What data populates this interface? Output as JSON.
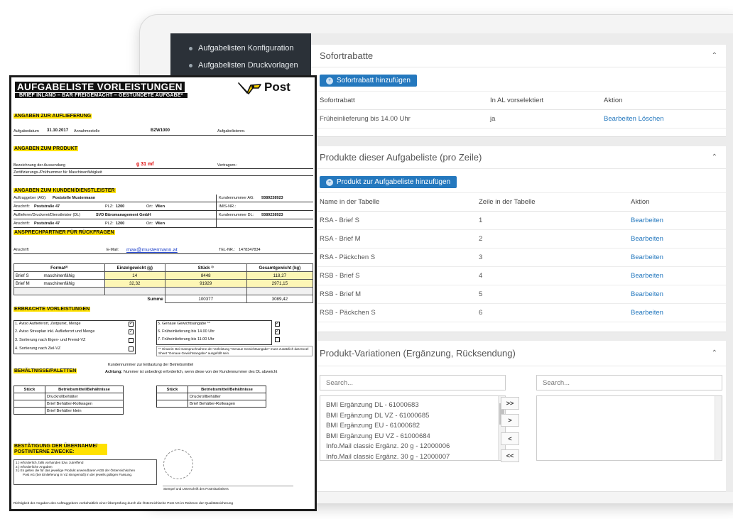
{
  "sidebar": {
    "items": [
      {
        "label": "Aufgabelisten Konfiguration"
      },
      {
        "label": "Aufgabelisten Druckvorlagen"
      }
    ]
  },
  "sofortrabatte": {
    "title": "Sofortrabatte",
    "add_button": "Sofortrabatt hinzufügen",
    "columns": [
      "Sofortrabatt",
      "In AL vorselektiert",
      "Aktion"
    ],
    "rows": [
      {
        "name": "Früheinlieferung bis 14.00 Uhr",
        "preselected": "ja",
        "edit": "Bearbeiten",
        "delete": "Löschen"
      }
    ]
  },
  "produkte": {
    "title": "Produkte dieser Aufgabeliste (pro Zeile)",
    "add_button": "Produkt zur Aufgabeliste hinzufügen",
    "columns": [
      "Name in der Tabelle",
      "Zeile in der Tabelle",
      "Aktion"
    ],
    "rows": [
      {
        "name": "RSA - Brief S",
        "line": "1",
        "action": "Bearbeiten"
      },
      {
        "name": "RSA - Brief M",
        "line": "2",
        "action": "Bearbeiten"
      },
      {
        "name": "RSA - Päckchen S",
        "line": "3",
        "action": "Bearbeiten"
      },
      {
        "name": "RSB - Brief S",
        "line": "4",
        "action": "Bearbeiten"
      },
      {
        "name": "RSB - Brief M",
        "line": "5",
        "action": "Bearbeiten"
      },
      {
        "name": "RSB - Päckchen S",
        "line": "6",
        "action": "Bearbeiten"
      }
    ]
  },
  "variationen": {
    "title": "Produkt-Variationen (Ergänzung, Rücksendung)",
    "search_left_placeholder": "Search...",
    "search_right_placeholder": "Search...",
    "options": [
      "BMI Ergänzung DL - 61000683",
      "BMI Ergänzung DL VZ - 61000685",
      "BMI Ergänzung EU - 61000682",
      "BMI Ergänzung EU VZ - 61000684",
      "Info.Mail classic Ergänz. 20 g - 12000006",
      "Info.Mail classic Ergänz. 30 g - 12000007"
    ],
    "move_buttons": [
      ">>",
      ">",
      "<",
      "<<"
    ]
  },
  "form": {
    "title": "AUFGABELISTE VORLEISTUNGEN",
    "subtitle": "BRIEF INLAND – BAR FREIGEMACHT – GESTUNDETE AUFGABE*",
    "logo_text": "Post",
    "sec_auflieferung": "ANGABEN ZUR AUFLIEFERUNG",
    "aufgabedatum_label": "Aufgabedatum",
    "aufgabedatum": "31.10.2017",
    "annahmestelle_label": "Annahmestelle",
    "annahmestelle": "BZW1000",
    "aufgabelistennr_label": "Aufgabelistennr.",
    "sec_produkt": "ANGABEN ZUM PRODUKT",
    "bezeichnung_label": "Bezeichnung der Aussendung",
    "bezeichnung": "g 31 mf",
    "vertragsnr_label": "Vertragsnr.:",
    "zertifizierung_label": "Zertifizierungs-/Prüfnummer für Maschinenfähigkeit",
    "sec_kunden": "ANGABEN ZUM KUNDEN/DIENSTLEISTER",
    "auftraggeber_label": "Auftraggeber (AG):",
    "auftraggeber": "Poststelle Mustermann",
    "kundennummer_ag_label": "Kundennummer AG:",
    "kundennummer_ag": "9389238923",
    "anschrift_label": "Anschrift:",
    "anschrift1": "Poststraße 47",
    "plz_label": "PLZ:",
    "plz1": "1200",
    "ort_label": "Ort:",
    "ort1": "Wien",
    "imis_label": "IMIS-NR.:",
    "auflieferer_label": "Auflieferer/Druckerei/Dienstleister (DL)",
    "auflieferer": "SVD Büromanagement GmbH",
    "kundennummer_dl_label": "Kundennummer DL:",
    "kundennummer_dl": "9389238923",
    "anschrift2": "Poststraße 47",
    "plz2": "1200",
    "ort2": "Wien",
    "sec_ansprech": "ANSPRECHPARTNER FÜR RÜCKFRAGEN",
    "ansprech_anschrift_label": "Anschrift",
    "email_label": "E-Mail:",
    "email": "max@mustermann.at",
    "tel_label": "TEL-NR.:",
    "tel": "1478347834",
    "table_headers": [
      "Format²⁾",
      "Einzelgewicht (g)",
      "Stück ³⁾",
      "Gesamtgewicht (kg)"
    ],
    "table_rows": [
      {
        "label": "Brief S",
        "format": "maschinenfähig",
        "weight": "14",
        "pieces": "8448",
        "total": "118,27"
      },
      {
        "label": "Brief M",
        "format": "maschinenfähig",
        "weight": "32,32",
        "pieces": "91929",
        "total": "2971,15"
      }
    ],
    "summe_label": "Summe",
    "summe_pieces": "100377",
    "summe_total": "3089,42",
    "sec_vorleistungen": "ERBRACHTE VORLEISTUNGEN",
    "vorleistungen_left": [
      {
        "text": "1. Aviso Auflieferort, Zeitpunkt, Menge",
        "checked": "✓"
      },
      {
        "text": "2. Aviso Streuplan inkl. Auflieferort und Menge",
        "checked": "✓"
      },
      {
        "text": "3. Sortierung nach Eigen- und Fremd-VZ",
        "checked": ""
      },
      {
        "text": "4. Sortierung nach Ziel-VZ",
        "checked": ""
      }
    ],
    "vorleistungen_right": [
      {
        "text": "5. Genaue Gewichtsangabe **",
        "checked": "✓"
      },
      {
        "text": "6. Früheinlieferung bis 14.00 Uhr",
        "checked": "✓"
      },
      {
        "text": "7. Früheinlieferung bis 11.00 Uhr",
        "checked": ""
      }
    ],
    "hinweis": "** Hinweis: Bei Inanspruchnahme der Vorleistung \"Genaue Gewichtsangabe\" muss zusätzlich das Excel Sheet \"Genaue Gewichtsangabe\" ausgefüllt sein.",
    "kundennummer_entlastung": "Kundennummer zur Entlastung der Betriebsmittel",
    "achtung_label": "Achtung:",
    "achtung_text": "Nummer ist unbedingt erforderlich, wenn diese von der Kundennummer des DL abweicht",
    "sec_behaeltnisse": "BEHÄLTNISSE/PALETTEN",
    "beh_headers": [
      "Stück",
      "Betriebsmittel/Behältnisse"
    ],
    "beh_left": [
      "Druckrollbehälter",
      "Brief Behälter-Rollwagen",
      "Brief Behälter klein"
    ],
    "beh_right": [
      "Druckrollbehälter",
      "Brief Behälter-Rollwagen"
    ],
    "sec_bestaetigung": "BESTÄTIGUNG DER ÜBERNAHME/ POSTINTERNE ZWECKE:",
    "footnotes": [
      "1.) erforderlich, falls vorhanden bzw. zutreffend",
      "2.) erforderliche Angaben",
      "3.) Es gelten die für das jeweilige Produkt anwendbaren AGB der Österreichischen",
      "Post AG (bei Einlieferung in VZ sinngemäß) in der jeweils gültigen Fassung."
    ],
    "stempel": "Stempel und Unterschrift des Postmitarbeiters",
    "footer": "Richtigkeit der Angaben des Auftraggebers vorbehaltlich einer Überprüfung durch die Österreichische Post AG im Rahmen der Qualitätssicherung"
  },
  "colors": {
    "sidebar_bg": "#2b3138",
    "button_blue": "#2478be",
    "link_blue": "#2478be",
    "highlight_yellow": "#ffe100",
    "row_yellow": "#fdf6b5"
  }
}
